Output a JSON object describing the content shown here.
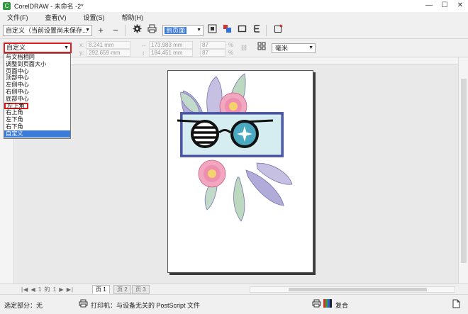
{
  "window": {
    "title": "CorelDRAW - 未命名 -2*",
    "app_icon_glyph": "C",
    "controls": {
      "minimize": "—",
      "restore": "☐",
      "close": "✕"
    }
  },
  "menu": [
    {
      "label": "文件(F)"
    },
    {
      "label": "查看(V)"
    },
    {
      "label": "设置(S)"
    },
    {
      "label": "帮助(H)"
    }
  ],
  "toolbar": {
    "preset_value": "自定义（当前设置尚未保存...",
    "add_icon": "plus-icon",
    "remove_icon": "minus-icon",
    "zoom_value": "到页面",
    "icons": [
      "gear-icon",
      "print-icon",
      "fit-page-icon",
      "layout-icon",
      "page-icon",
      "mirror-icon",
      "close-preview-icon"
    ]
  },
  "propbar": {
    "page_position_value": "自定义",
    "x_value": "8.241 mm",
    "y_value": "292.659 mm",
    "width_value": "173.983 mm",
    "height_value": "184.451 mm",
    "scale_w": "87",
    "scale_h": "87",
    "scale_unit": "%",
    "unit_value": "毫米"
  },
  "dropdown": {
    "items": [
      "与文档相同",
      "调整到页面大小",
      "页面中心",
      "顶部中心",
      "左侧中心",
      "右侧中心",
      "底部中心",
      "左上角",
      "右上角",
      "左下角",
      "右下角",
      "自定义"
    ],
    "marked_index": 7,
    "selected_index": 11
  },
  "pages": {
    "nav": "|◀ ◀ 1 的 1 ▶ ▶|",
    "tabs": [
      "页 1",
      "页 2",
      "页 3"
    ],
    "active": 0
  },
  "status": {
    "selection": "选定部分：无",
    "printer": "打印机：与设备无关的 PostScript 文件",
    "mode": "复合"
  },
  "colors": {
    "accent_blue": "#3d7bd8",
    "highlight_red": "#d81e1e",
    "glasses_frame": "#5a65b0",
    "glasses_bg": "#cfe8ee",
    "leaf_purple": "#9f9ad0",
    "leaf_green": "#b9d6b0",
    "flower_pink": "#ee8fb0"
  }
}
